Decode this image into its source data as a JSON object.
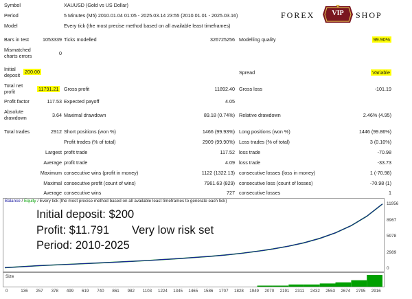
{
  "logo": {
    "left": "FOREX",
    "badge": "VIP",
    "right": "SHOP"
  },
  "info": {
    "symbol_label": "Symbol",
    "symbol_value": "XAUUSD (Gold vs US Dollar)",
    "period_label": "Period",
    "period_value": "5 Minutes (M5) 2010.01.04 01:05 - 2025.03.14 23:55 (2010.01.01 - 2025.03.16)",
    "model_label": "Model",
    "model_value": "Every tick (the most precise method based on all available least timeframes)"
  },
  "stats": {
    "bars_label": "Bars in test",
    "bars_value": "1053339",
    "ticks_label": "Ticks modelled",
    "ticks_value": "326725256",
    "quality_label": "Modelling quality",
    "quality_value": "99.90%",
    "mismatch_label_1": "Mismatched",
    "mismatch_label_2": "charts errors",
    "mismatch_value": "0",
    "deposit_label_1": "Initial",
    "deposit_label_2": "deposit",
    "deposit_value": "200.00",
    "spread_label": "Spread",
    "spread_value": "Variable",
    "net_label_1": "Total net",
    "net_label_2": "profit",
    "net_value": "11791.21",
    "gross_profit_label": "Gross profit",
    "gross_profit_value": "11892.40",
    "gross_loss_label": "Gross loss",
    "gross_loss_value": "-101.19",
    "pf_label": "Profit factor",
    "pf_value": "117.53",
    "payoff_label": "Expected payoff",
    "payoff_value": "4.05",
    "abs_dd_label_1": "Absolute",
    "abs_dd_label_2": "drawdown",
    "abs_dd_value": "3.64",
    "max_dd_label": "Maximal drawdown",
    "max_dd_value": "89.18 (0.74%)",
    "rel_dd_label": "Relative drawdown",
    "rel_dd_value": "2.46% (4.95)",
    "trades_label": "Total trades",
    "trades_value": "2912",
    "short_label": "Short positions (won %)",
    "short_value": "1466 (99.93%)",
    "long_label": "Long positions (won %)",
    "long_value": "1446 (99.86%)",
    "profit_trades_label": "Profit trades (% of total)",
    "profit_trades_value": "2909 (99.90%)",
    "loss_trades_label": "Loss trades (% of total)",
    "loss_trades_value": "3 (0.10%)",
    "largest_label": "Largest",
    "largest_profit_label": "profit trade",
    "largest_profit_value": "117.52",
    "largest_loss_label": "loss trade",
    "largest_loss_value": "-70.98",
    "average_label": "Average",
    "average_profit_label": "profit trade",
    "average_profit_value": "4.09",
    "average_loss_label": "loss trade",
    "average_loss_value": "-33.73",
    "maximum_label": "Maximum",
    "max_wins_label": "consecutive wins (profit in money)",
    "max_wins_value": "1122 (1322.13)",
    "max_losses_label": "consecutive losses (loss in money)",
    "max_losses_value": "1 (-70.98)",
    "maximal_label": "Maximal",
    "maximal_profit_label": "consecutive profit (count of wins)",
    "maximal_profit_value": "7961.63 (829)",
    "maximal_loss_label": "consecutive loss (count of losses)",
    "maximal_loss_value": "-70.98 (1)",
    "average2_label": "Average",
    "avg_wins_label": "consecutive wins",
    "avg_wins_value": "727",
    "avg_losses_label": "consecutive losses",
    "avg_losses_value": "1"
  },
  "chart_header": {
    "balance": "Balance",
    "sep": " / ",
    "equity": "Equity",
    "rest": " / Every tick (the most precise method based on all available least timeframes to generate each tick)"
  },
  "overlay": {
    "deposit": "Initial deposit: $200",
    "profit": "Profit: $11.791",
    "risk": "Very low risk set",
    "period": "Period: 2010-2025"
  },
  "size_label": "Size",
  "colors": {
    "balance": "#1a1aa0",
    "equity": "#00a000",
    "highlight": "#ffff00"
  },
  "chart_data": {
    "type": "line",
    "y_ticks": [
      "11956",
      "8967",
      "5978",
      "2989",
      "0"
    ],
    "x_ticks": [
      "0",
      "136",
      "257",
      "378",
      "499",
      "619",
      "740",
      "861",
      "982",
      "1103",
      "1224",
      "1345",
      "1465",
      "1586",
      "1707",
      "1828",
      "1949",
      "2070",
      "2191",
      "2311",
      "2432",
      "2553",
      "2674",
      "2795",
      "2916"
    ],
    "ylim": [
      0,
      11956
    ],
    "xlim": [
      0,
      2916
    ],
    "series": [
      {
        "x": [
          0,
          136,
          257,
          378,
          499,
          619,
          740,
          861,
          982,
          1103,
          1224,
          1345,
          1465,
          1586,
          1707,
          1828,
          1949,
          2070,
          2191,
          2311,
          2432,
          2553,
          2674,
          2795,
          2916
        ],
        "y": [
          200,
          400,
          560,
          700,
          830,
          960,
          1090,
          1230,
          1380,
          1530,
          1700,
          1880,
          2080,
          2300,
          2560,
          2860,
          3230,
          3660,
          4180,
          4810,
          5620,
          6650,
          7970,
          9720,
          11991
        ]
      }
    ],
    "size_bars": {
      "x": [
        1949,
        2070,
        2191,
        2311,
        2432,
        2553,
        2674,
        2795,
        2916
      ],
      "y": [
        1,
        1,
        1,
        2,
        2,
        3,
        4,
        6,
        11
      ]
    }
  }
}
